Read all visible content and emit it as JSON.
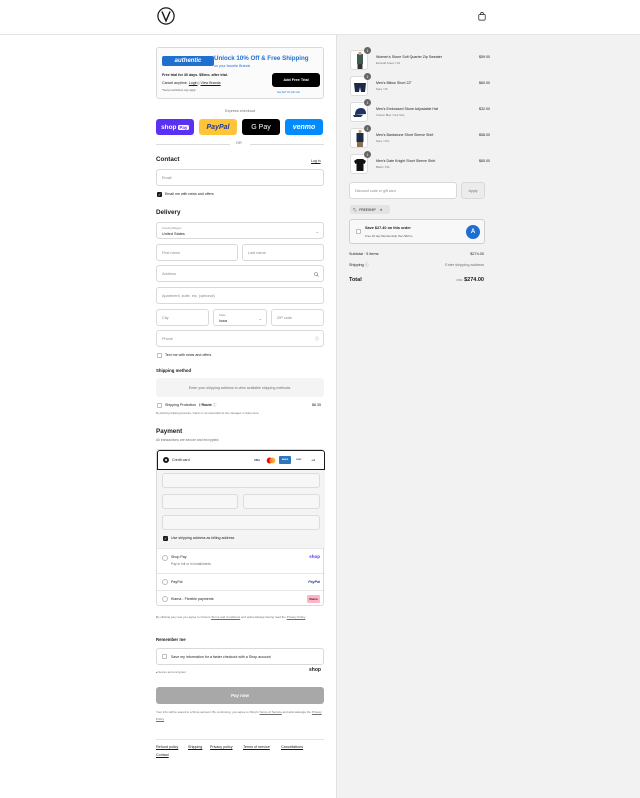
{
  "header": {
    "logo_icon": "volcom-stone-logo",
    "bag_icon": "shopping-bag-icon"
  },
  "promo": {
    "brand": "authentic",
    "title": "Unlock 10% Off & Free Shipping",
    "subtitle": "on your favorite Brands",
    "line1": "Free trial for 30 days. $5/mo. after trial.",
    "line2_prefix": "Cancel anytime. ",
    "line2_login": "Login",
    "line2_sep": " | ",
    "line2_view": "View Brands",
    "line3": "*Some restrictions may apply",
    "cta": "Add Free Trial",
    "see_link": "See $27.40 with trial"
  },
  "express": {
    "label": "Express checkout",
    "buttons": [
      {
        "label": "shop Pay",
        "color": "#5a31f4"
      },
      {
        "label": "PayPal",
        "color": "#ffc439"
      },
      {
        "label": "G Pay",
        "color": "#000000"
      },
      {
        "label": "venmo",
        "color": "#008cff"
      }
    ],
    "or": "OR"
  },
  "contact": {
    "heading": "Contact",
    "login": "Log in",
    "email_placeholder": "Email",
    "news_label": "Email me with news and offers"
  },
  "delivery": {
    "heading": "Delivery",
    "country_label": "Country/Region",
    "country_value": "United States",
    "first_name": "First name",
    "last_name": "Last name",
    "address": "Address",
    "apartment": "Apartment, suite, etc. (optional)",
    "city": "City",
    "state_label": "State",
    "state_value": "Iowa",
    "zip": "ZIP code",
    "phone": "Phone",
    "text_label": "Text me with news and offers"
  },
  "shipping": {
    "heading": "Shipping method",
    "note": "Enter your shipping address to view available shipping methods.",
    "protection_label": "Shipping Protection",
    "protection_brand": "Route",
    "protection_price": "$8.35",
    "protection_legal": "By declining shipping protection, Volcom is not responsible for lost, damaged, or stolen items."
  },
  "payment": {
    "heading": "Payment",
    "subtitle": "All transactions are secure and encrypted.",
    "credit_card": "Credit card",
    "card_logos": [
      "VISA",
      "MC",
      "AMEX",
      "DISC",
      "+4"
    ],
    "billing_same": "Use shipping address as billing address",
    "methods": [
      {
        "label": "Shop Pay",
        "sub": "Pay in full or in installments",
        "logo": "shop"
      },
      {
        "label": "PayPal",
        "sub": "",
        "logo": "PayPal"
      },
      {
        "label": "Klarna - Flexible payments",
        "sub": "",
        "logo": "Klarna"
      }
    ]
  },
  "legal": {
    "consent_prefix": "By clicking pay now you agree to Volcom ",
    "consent_terms": "Terms and Conditions",
    "consent_mid": " and acknowledge having read the ",
    "consent_privacy": "Privacy Policy"
  },
  "remember": {
    "heading": "Remember me",
    "save_label": "Save my information for a faster checkout with a Shop account",
    "secure": "Secure and encrypted",
    "shop_logo": "shop"
  },
  "pay_now": "Pay now",
  "footer_legal": {
    "prefix": "Your info will be saved to a Shop account. By continuing, you agree to Shop's ",
    "terms": "Terms of Service",
    "mid": " and acknowledge the ",
    "privacy": "Privacy Policy"
  },
  "footer_links": [
    "Refund policy",
    "Shipping",
    "Privacy policy",
    "Terms of service",
    "Cancellations",
    "Contact"
  ],
  "cart": {
    "items": [
      {
        "name": "Women's Stone Soft Quarter Zip Sweater",
        "variant": "Emerald Green / XS",
        "price": "$59.00",
        "qty": "1"
      },
      {
        "name": "Men's Billow Short 22\"",
        "variant": "Navy / 30",
        "price": "$60.00",
        "qty": "1"
      },
      {
        "name": "Men's Embossed Stone Adjustable Hat",
        "variant": "Cosmic Blue / One Size",
        "price": "$32.00",
        "qty": "1"
      },
      {
        "name": "Men's Bankstone Short Sleeve Shirt",
        "variant": "Navy / XXL",
        "price": "$58.00",
        "qty": "1"
      },
      {
        "name": "Men's Date Knight Short Sleeve Shirt",
        "variant": "Black / XXL",
        "price": "$65.00",
        "qty": "1"
      }
    ],
    "discount_placeholder": "Discount code or gift card",
    "apply": "Apply",
    "tag": "FREESHIP",
    "offer_title": "Save $27.40 on this order",
    "offer_sub": "Free 30 day Membership then $5/mo.",
    "subtotal_label": "Subtotal · 5 items",
    "subtotal_value": "$274.00",
    "shipping_label": "Shipping",
    "shipping_value": "Enter shipping address",
    "total_label": "Total",
    "currency": "USD",
    "total_value": "$274.00"
  }
}
